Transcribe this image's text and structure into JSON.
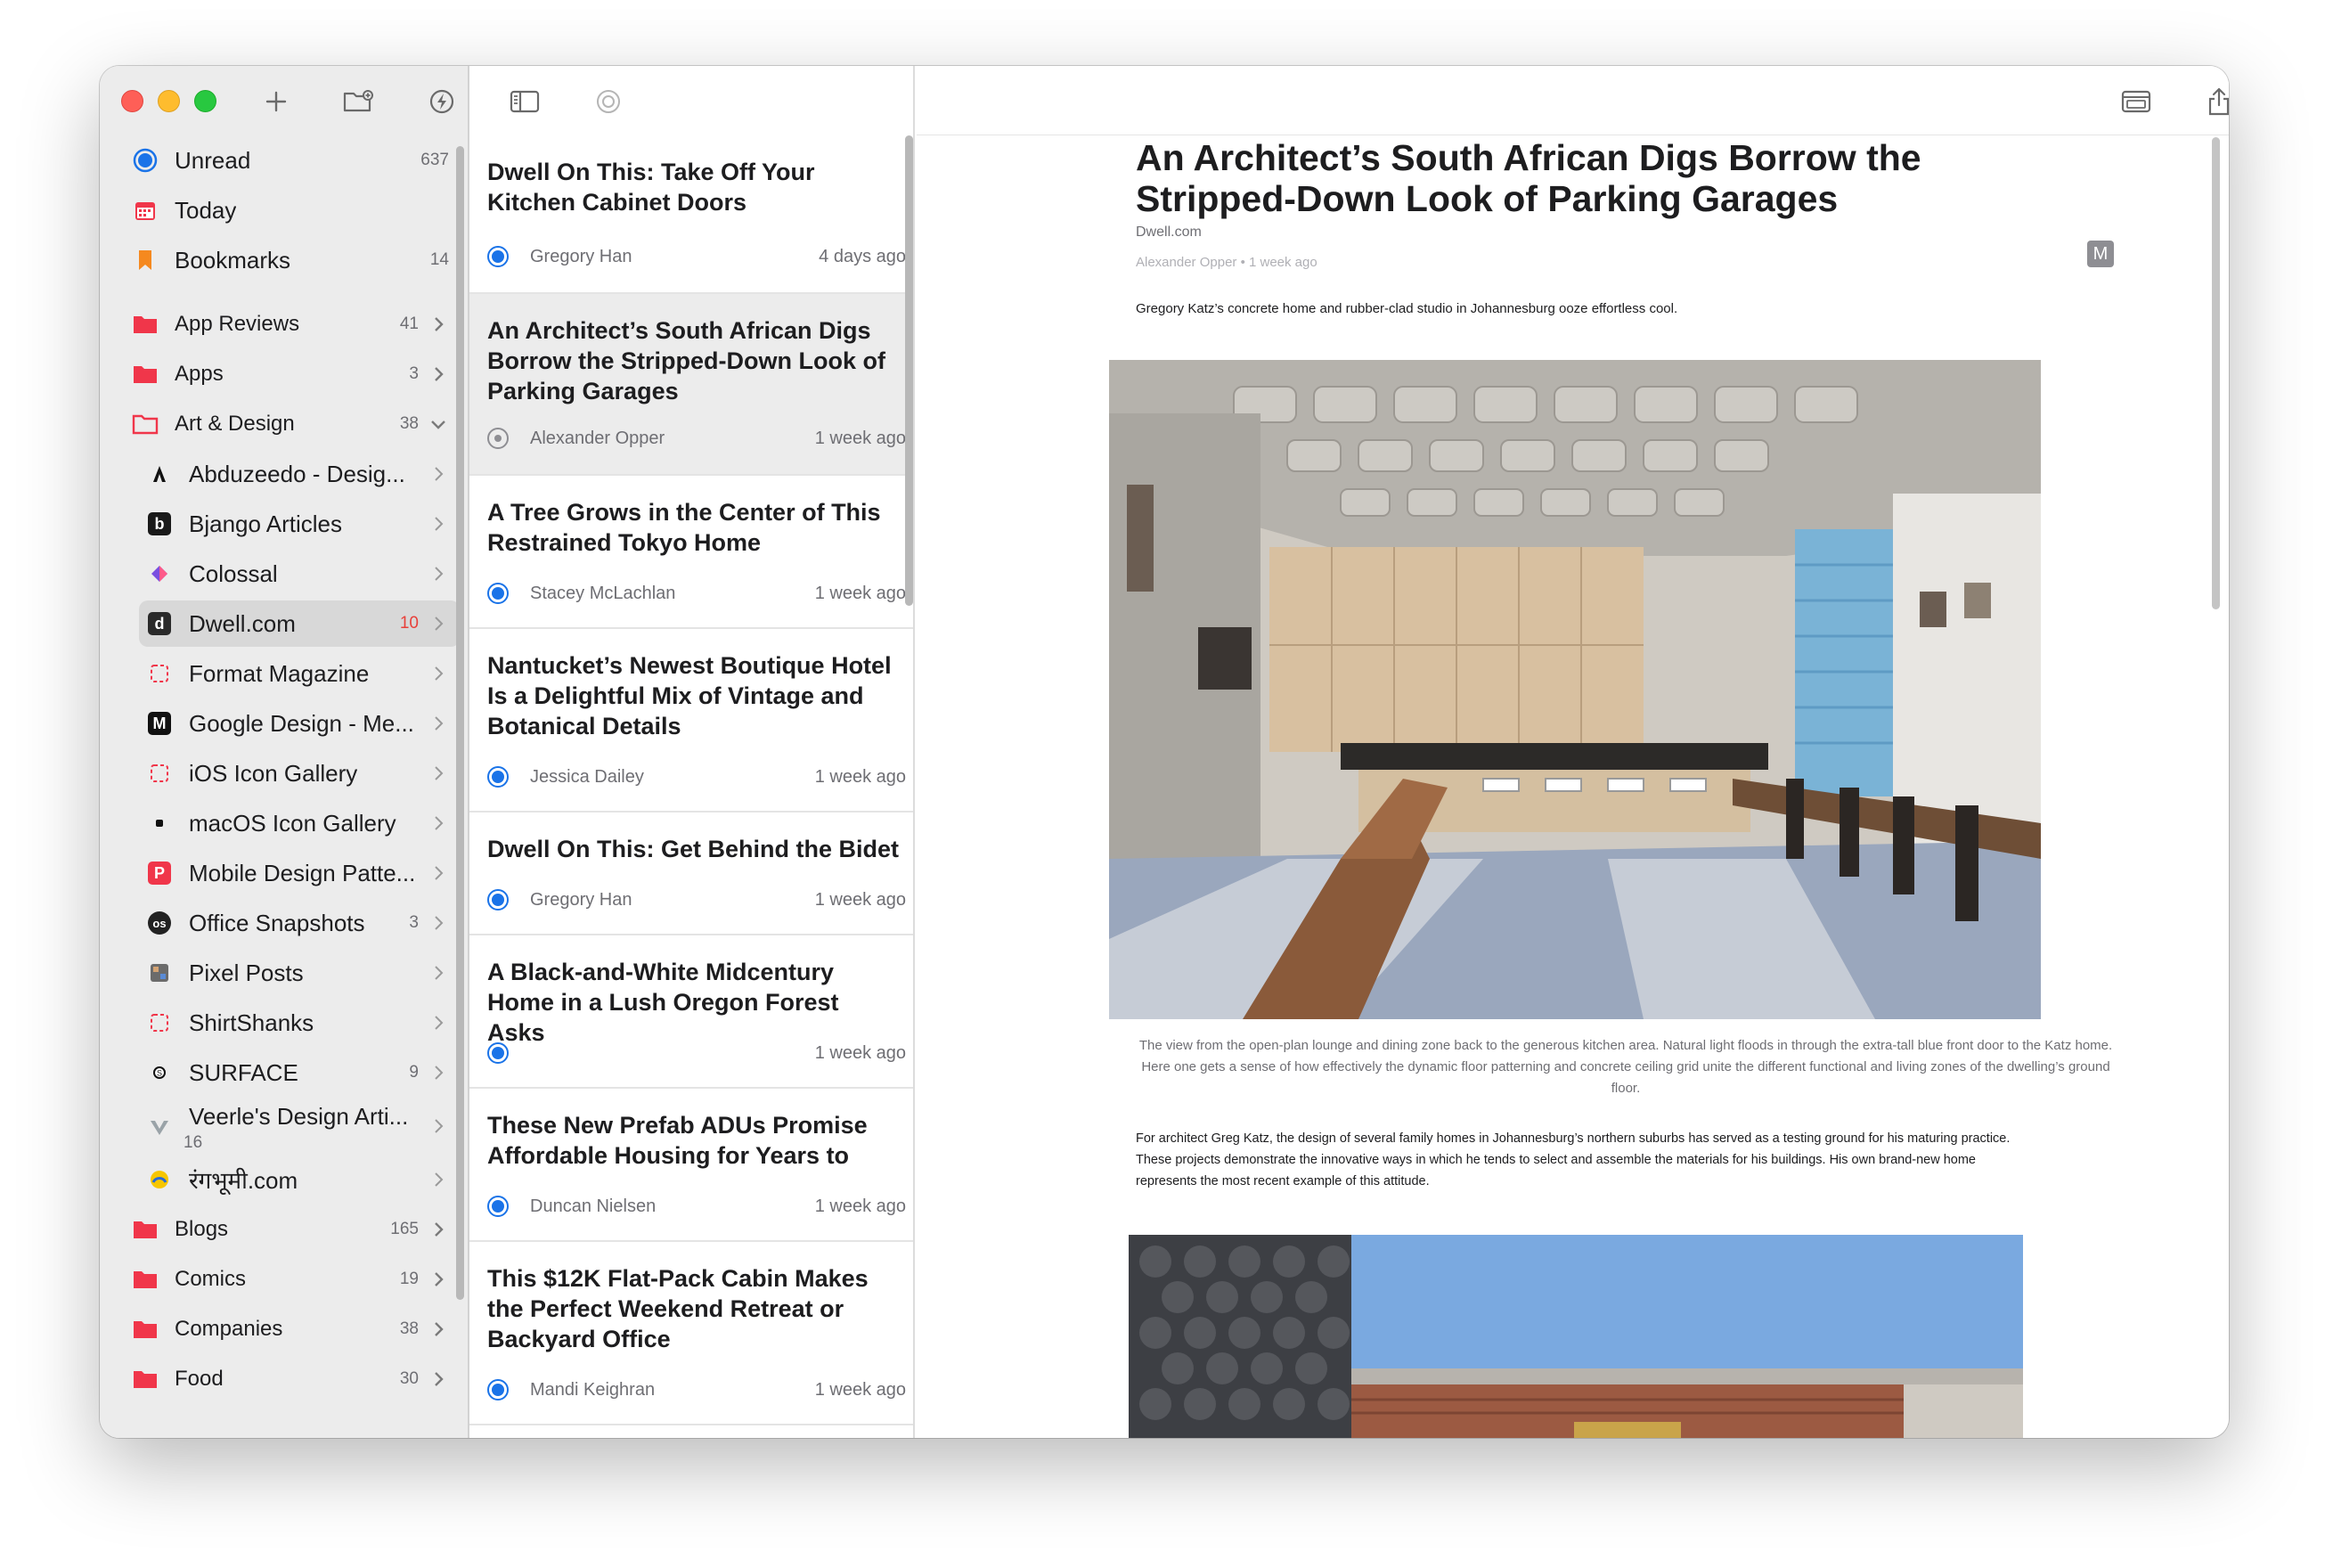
{
  "sidebar": {
    "smart_feeds": [
      {
        "label": "Unread",
        "count": "637",
        "icon": "unread-circle-icon"
      },
      {
        "label": "Today",
        "count": "",
        "icon": "calendar-icon"
      },
      {
        "label": "Bookmarks",
        "count": "14",
        "icon": "bookmark-icon"
      }
    ],
    "folders_top": [
      {
        "label": "App Reviews",
        "count": "41"
      },
      {
        "label": "Apps",
        "count": "3"
      },
      {
        "label": "Art & Design",
        "count": "38"
      }
    ],
    "feeds": [
      {
        "label": "Abduzeedo - Desig...",
        "count": ""
      },
      {
        "label": "Bjango Articles",
        "count": ""
      },
      {
        "label": "Colossal",
        "count": ""
      },
      {
        "label": "Dwell.com",
        "count": "10"
      },
      {
        "label": "Format Magazine",
        "count": ""
      },
      {
        "label": "Google Design - Me...",
        "count": ""
      },
      {
        "label": "iOS Icon Gallery",
        "count": ""
      },
      {
        "label": "macOS Icon Gallery",
        "count": ""
      },
      {
        "label": "Mobile Design Patte...",
        "count": ""
      },
      {
        "label": "Office Snapshots",
        "count": "3"
      },
      {
        "label": "Pixel Posts",
        "count": ""
      },
      {
        "label": "ShirtShanks",
        "count": ""
      },
      {
        "label": "SURFACE",
        "count": "9"
      },
      {
        "label": "Veerle's Design Arti...",
        "count": "16"
      },
      {
        "label": "रंगभूमी.com",
        "count": ""
      }
    ],
    "folders_bottom": [
      {
        "label": "Blogs",
        "count": "165"
      },
      {
        "label": "Comics",
        "count": "19"
      },
      {
        "label": "Companies",
        "count": "38"
      },
      {
        "label": "Food",
        "count": "30"
      }
    ]
  },
  "articles": [
    {
      "title": "Dwell On This: Take Off Your Kitchen Cabinet Doors",
      "author": "Gregory Han",
      "time": "4 days ago",
      "read": false
    },
    {
      "title": "An Architect’s South African Digs Borrow the Stripped-Down Look of Parking Garages",
      "author": "Alexander Opper",
      "time": "1 week ago",
      "read": true
    },
    {
      "title": "A Tree Grows in the Center of This Restrained Tokyo Home",
      "author": "Stacey McLachlan",
      "time": "1 week ago",
      "read": false
    },
    {
      "title": "Nantucket’s Newest Boutique Hotel Is a Delightful Mix of Vintage and Botanical Details",
      "author": "Jessica Dailey",
      "time": "1 week ago",
      "read": false
    },
    {
      "title": "Dwell On This: Get Behind the Bidet",
      "author": "Gregory Han",
      "time": "1 week ago",
      "read": false
    },
    {
      "title": "A Black-and-White Midcentury Home in a Lush Oregon Forest Asks",
      "author": "",
      "time": "1 week ago",
      "read": false
    },
    {
      "title": "These New Prefab ADUs Promise Affordable Housing for Years to",
      "author": "Duncan Nielsen",
      "time": "1 week ago",
      "read": false
    },
    {
      "title": "This $12K Flat-Pack Cabin Makes the Perfect Weekend Retreat or Backyard Office",
      "author": "Mandi Keighran",
      "time": "1 week ago",
      "read": false
    }
  ],
  "reader": {
    "title": "An Architect’s South African Digs Borrow the Stripped-Down Look of Parking Garages",
    "source": "Dwell.com",
    "byline": "Alexander Opper • 1 week ago",
    "badge": "M",
    "subtitle": "Gregory Katz’s concrete home and rubber-clad studio in Johannesburg ooze effortless cool.",
    "caption": "The view from the open-plan lounge and dining zone back to the generous kitchen area. Natural light floods in through the extra-tall blue front door to the Katz home. Here one gets a sense of how effectively the dynamic floor patterning and concrete ceiling grid unite the different functional and living zones of the dwelling’s ground floor.",
    "body": "For architect Greg Katz, the design of several family homes in Johannesburg’s northern suburbs has served as a testing ground for his maturing practice. These projects demonstrate the innovative ways in which he tends to select and assemble the materials for his buildings. His own brand-new home represents the most recent example of this attitude."
  },
  "colors": {
    "accent_blue": "#1a73e8",
    "folder_red": "#f0364a",
    "unread_count_red": "#e8403a"
  }
}
